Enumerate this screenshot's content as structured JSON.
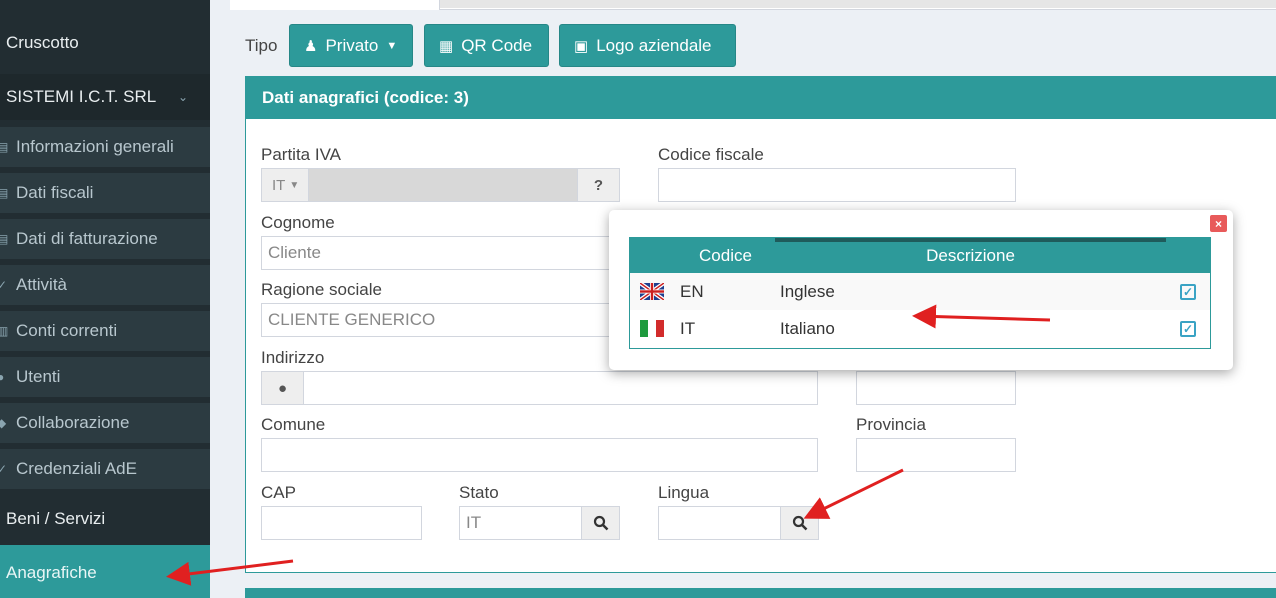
{
  "sidebar": {
    "dashboard": "Cruscotto",
    "company": "SISTEMI I.C.T. SRL",
    "items": [
      {
        "label": "Informazioni generali",
        "icon": "file-icon"
      },
      {
        "label": "Dati fiscali",
        "icon": "file-icon"
      },
      {
        "label": "Dati di fatturazione",
        "icon": "file-icon"
      },
      {
        "label": "Attività",
        "icon": "check-icon"
      },
      {
        "label": "Conti correnti",
        "icon": "bank-icon"
      },
      {
        "label": "Utenti",
        "icon": "user-icon"
      },
      {
        "label": "Collaborazione",
        "icon": "share-icon"
      },
      {
        "label": "Credenziali AdE",
        "icon": "key-icon"
      }
    ],
    "goods": "Beni / Servizi",
    "registry": "Anagrafiche"
  },
  "toolbar": {
    "tipo_label": "Tipo",
    "privato_label": "Privato",
    "qrcode_label": "QR Code",
    "logo_label": "Logo aziendale"
  },
  "panel": {
    "title": "Dati anagrafici (codice: 3)"
  },
  "form": {
    "partita_iva_label": "Partita IVA",
    "country_prefix": "IT",
    "help": "?",
    "codice_fiscale_label": "Codice fiscale",
    "cognome_label": "Cognome",
    "cognome_value": "Cliente",
    "ragione_sociale_label": "Ragione sociale",
    "ragione_sociale_value": "CLIENTE GENERICO",
    "indirizzo_label": "Indirizzo",
    "comune_label": "Comune",
    "provincia_label": "Provincia",
    "cap_label": "CAP",
    "stato_label": "Stato",
    "stato_value": "IT",
    "lingua_label": "Lingua"
  },
  "modal": {
    "close": "×",
    "headers": {
      "codice": "Codice",
      "descrizione": "Descrizione"
    },
    "rows": [
      {
        "flag": "uk-flag-icon",
        "codice": "EN",
        "descrizione": "Inglese"
      },
      {
        "flag": "italy-flag-icon",
        "codice": "IT",
        "descrizione": "Italiano"
      }
    ]
  },
  "colors": {
    "teal": "#2d9a9a",
    "sidebar": "#222d32",
    "annotation_arrow": "#e02020"
  }
}
